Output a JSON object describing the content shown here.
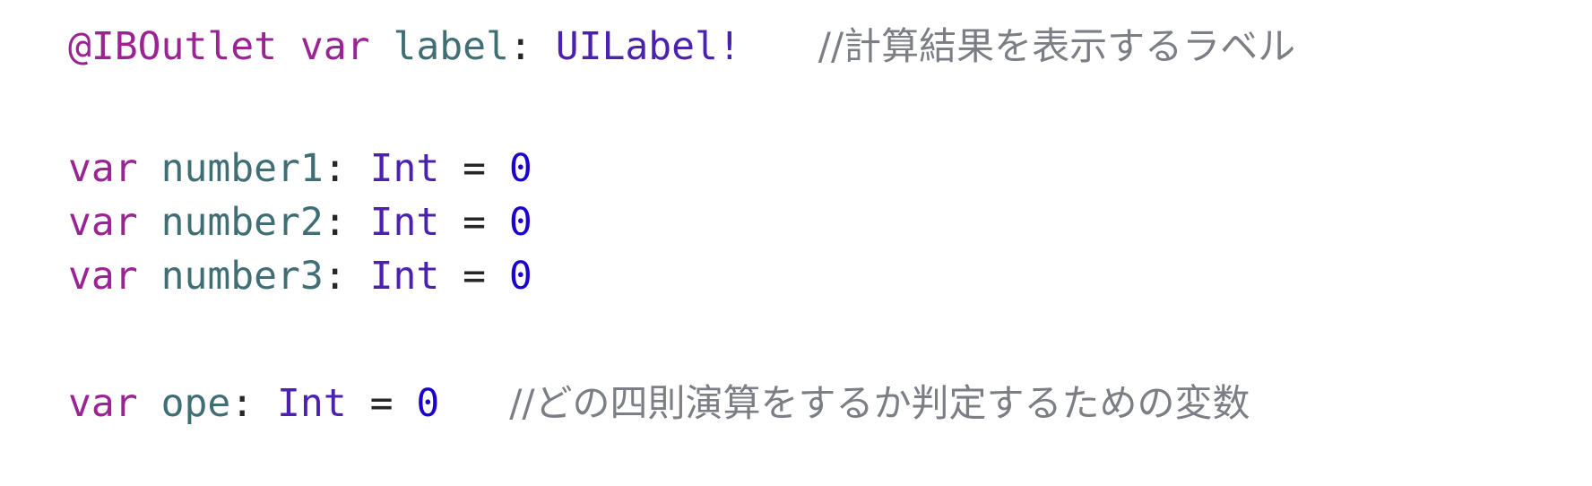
{
  "code": {
    "line1": {
      "attr": "@IBOutlet",
      "kw": "var",
      "name": "label",
      "colon": ":",
      "type": "UILabel!",
      "comment": "//計算結果を表示するラベル"
    },
    "line2": {
      "kw": "var",
      "name": "number1",
      "colon": ":",
      "type": "Int",
      "eq": "=",
      "value": "0"
    },
    "line3": {
      "kw": "var",
      "name": "number2",
      "colon": ":",
      "type": "Int",
      "eq": "=",
      "value": "0"
    },
    "line4": {
      "kw": "var",
      "name": "number3",
      "colon": ":",
      "type": "Int",
      "eq": "=",
      "value": "0"
    },
    "line5": {
      "kw": "var",
      "name": "ope",
      "colon": ":",
      "type": "Int",
      "eq": "=",
      "value": "0",
      "comment": "//どの四則演算をするか判定するための変数"
    }
  },
  "colors": {
    "keyword": "#9b2393",
    "identifier": "#3f6e74",
    "type": "#4b21b0",
    "number": "#1c00cf",
    "comment": "#7b7e84",
    "text": "#262626"
  }
}
